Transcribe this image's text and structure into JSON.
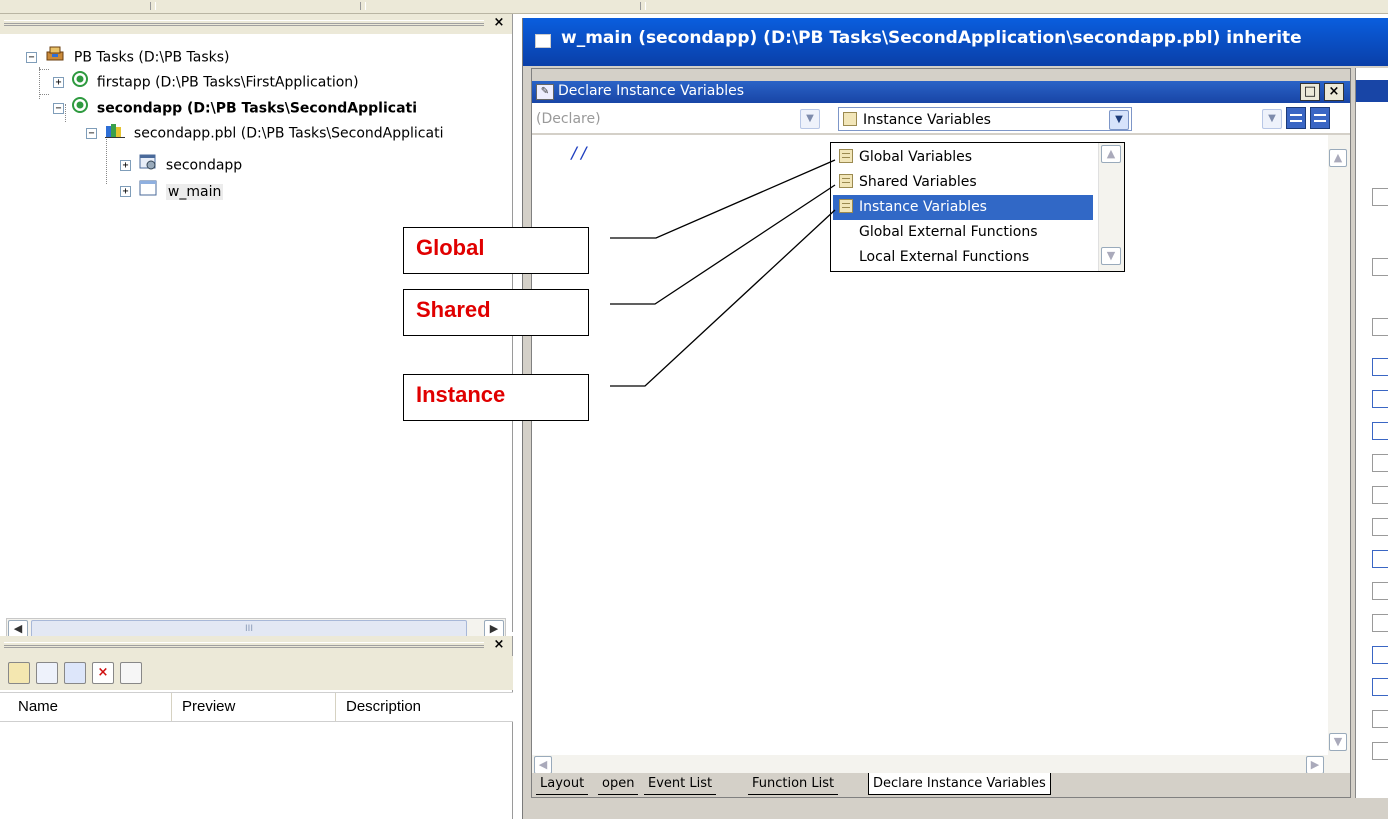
{
  "system_tree": {
    "workspace_label": "PB Tasks (D:\\PB Tasks)",
    "targets": [
      {
        "label": "firstapp (D:\\PB Tasks\\FirstApplication)",
        "expander": "+"
      },
      {
        "label": "secondapp (D:\\PB Tasks\\SecondApplicati",
        "expander": "−"
      }
    ],
    "library_label": "secondapp.pbl (D:\\PB Tasks\\SecondApplicati",
    "objects": [
      {
        "label": "secondapp",
        "expander": "+"
      },
      {
        "label": "w_main",
        "expander": "+"
      }
    ],
    "expander_workspace": "−",
    "expander_library": "−",
    "scroll_thumb_grip": "III"
  },
  "clip_pane": {
    "columns": [
      "Name",
      "Preview",
      "Description"
    ]
  },
  "painter": {
    "title": "w_main (secondapp) (D:\\PB Tasks\\SecondApplication\\secondapp.pbl) inherite",
    "script_caption": "Declare Instance Variables",
    "dropdown_left": "(Declare)",
    "dropdown_main": "Instance Variables",
    "code_text": "//",
    "tabs": [
      "Layout",
      "open",
      "Event List",
      "Function List",
      "Declare Instance Variables"
    ]
  },
  "dropdown_options": [
    "Global Variables",
    "Shared Variables",
    "Instance Variables",
    "Global External Functions",
    "Local External Functions"
  ],
  "dropdown_selected_index": 2,
  "callouts": {
    "global": "Global",
    "shared": "Shared",
    "instance": "Instance"
  },
  "glyphs": {
    "close": "×",
    "restore": "□",
    "scroll_up": "▲",
    "scroll_down": "▼",
    "scroll_left": "◀",
    "scroll_right": "▶",
    "dropdown_arrow": "▼"
  },
  "colors": {
    "title_bar": "#0a3fa8",
    "selection": "#3168c6",
    "callout_text": "#e00000"
  }
}
